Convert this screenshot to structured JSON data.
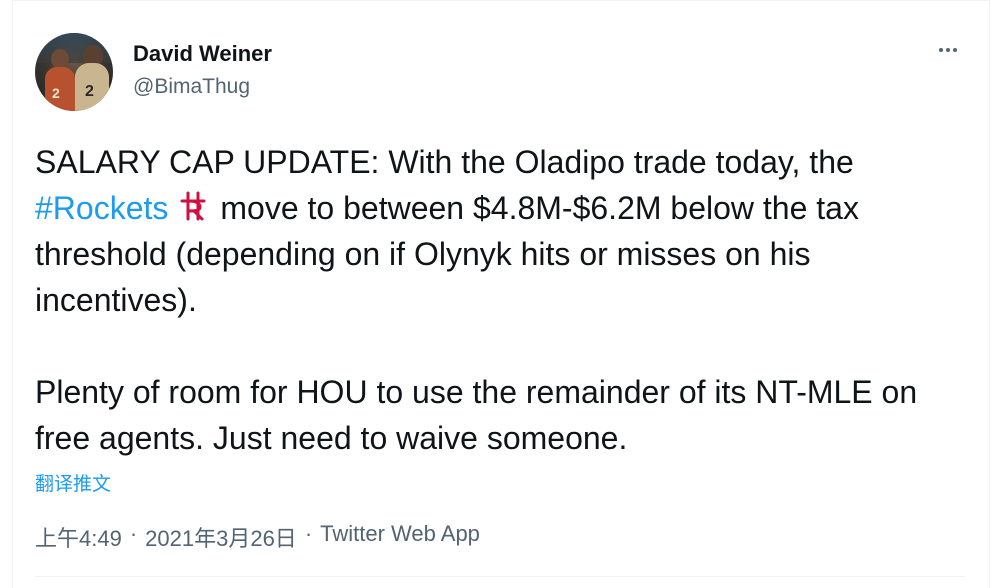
{
  "tweet": {
    "author_name": "David Weiner",
    "author_handle": "@BimaThug",
    "text_part1": "SALARY CAP UPDATE: With the Oladipo trade today, the ",
    "hashtag": "#Rockets",
    "text_part2": "move to between $4.8M-$6.2M below the tax threshold (depending on if Olynyk hits or misses on his incentives).",
    "paragraph2": "Plenty of room for HOU to use the remainder of its NT-MLE on free agents. Just need to waive someone.",
    "translate_label": "翻译推文",
    "time": "上午4:49",
    "date": "2021年3月26日",
    "source": "Twitter Web App",
    "separator": "·"
  },
  "avatar_numbers": [
    "2",
    "2"
  ],
  "icons": {
    "more": "more-horizontal-icon",
    "hashtag_emoji": "rockets-logo-icon"
  },
  "colors": {
    "link": "#1d9bf0",
    "secondary": "#536471",
    "primary_text": "#0f1419",
    "rockets_red": "#ce1141"
  }
}
